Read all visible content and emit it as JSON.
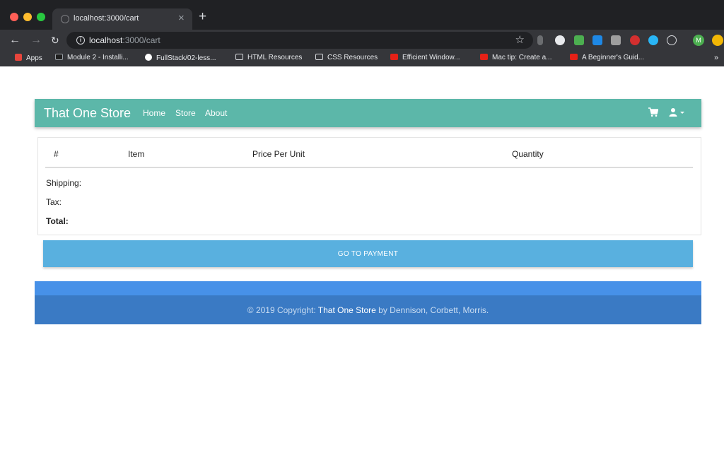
{
  "browser": {
    "tab_title": "localhost:3000/cart",
    "tab_close": "×",
    "new_tab": "+",
    "url_host": "localhost",
    "url_path": ":3000/cart",
    "bookmarks": [
      {
        "label": "Apps",
        "icon": "apps-grid-icon",
        "color": "#e8453c"
      },
      {
        "label": "Module 2 - Installi...",
        "icon": "book-icon",
        "color": "#1f1f1f"
      },
      {
        "label": "FullStack/02-less...",
        "icon": "github-icon",
        "color": "#ffffff"
      },
      {
        "label": "HTML Resources",
        "icon": "folder-icon",
        "color": "#dadce0"
      },
      {
        "label": "CSS Resources",
        "icon": "folder-icon",
        "color": "#dadce0"
      },
      {
        "label": "Efficient Window...",
        "icon": "youtube-icon",
        "color": "#e62117"
      },
      {
        "label": "Mac tip: Create a...",
        "icon": "youtube-icon",
        "color": "#e62117"
      },
      {
        "label": "A Beginner's Guid...",
        "icon": "youtube-icon",
        "color": "#e62117"
      }
    ],
    "bookmarks_overflow": "»",
    "profile_initial": "M"
  },
  "store": {
    "brand": "That One Store",
    "nav": [
      "Home",
      "Store",
      "About"
    ],
    "accent_color": "#5cb7a9"
  },
  "cart": {
    "columns": [
      "#",
      "Item",
      "Price Per Unit",
      "Quantity"
    ],
    "rows": [],
    "shipping_label": "Shipping:",
    "tax_label": "Tax:",
    "total_label": "Total:",
    "pay_button": "GO TO PAYMENT"
  },
  "footer": {
    "prefix": "© 2019 Copyright: ",
    "store_name": "That One Store",
    "suffix": " by Dennison, Corbett, Morris."
  }
}
